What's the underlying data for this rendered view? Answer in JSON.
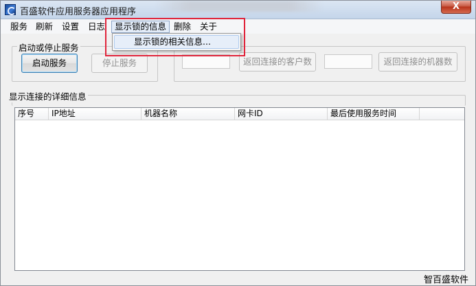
{
  "window": {
    "title": "百盛软件应用服务器应用程序",
    "close_symbol": "X",
    "accent": "#c75a44"
  },
  "menu": {
    "items": [
      {
        "label": "服务"
      },
      {
        "label": "刷新"
      },
      {
        "label": "设置"
      },
      {
        "label": "日志"
      },
      {
        "label": "显示锁的信息"
      },
      {
        "label": "删除"
      },
      {
        "label": "关于"
      }
    ],
    "dropdown": {
      "item": "显示锁的相关信息..."
    }
  },
  "service_group": {
    "label": "启动或停止服务",
    "start_button": "启动服务",
    "stop_button": "停止服务"
  },
  "connection_group": {
    "client_count_button": "返回连接的客户数",
    "machine_count_button": "返回连接的机器数"
  },
  "details_group": {
    "label": "显示连接的详细信息",
    "columns": [
      "序号",
      "IP地址",
      "机器名称",
      "网卡ID",
      "最后使用服务时间"
    ]
  },
  "status": {
    "text": "智百盛软件"
  }
}
